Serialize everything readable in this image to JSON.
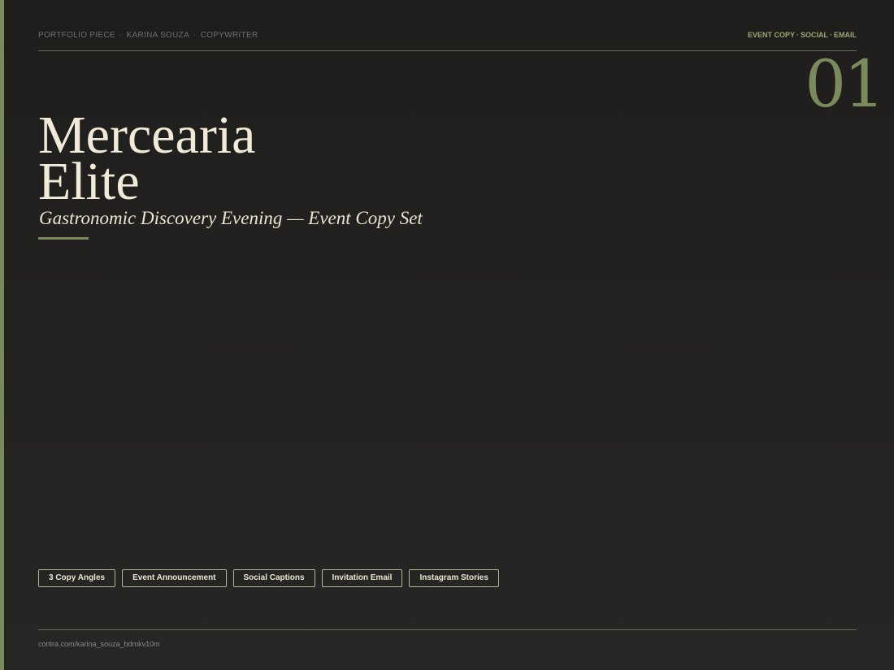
{
  "header": {
    "left_items": [
      "PORTFOLIO PIECE",
      "KARINA SOUZA",
      "COPYWRITER"
    ],
    "separator": "·",
    "right_items": [
      "EVENT COPY",
      "SOCIAL",
      "EMAIL"
    ]
  },
  "page_number": "01",
  "title": {
    "line1": "Mercearia",
    "line2": "Elite"
  },
  "subtitle": "Gastronomic Discovery Evening — Event Copy Set",
  "tags": [
    "3 Copy Angles",
    "Event Announcement",
    "Social Captions",
    "Invitation Email",
    "Instagram Stories"
  ],
  "footer": {
    "url": "contra.com/karina_souza_bdmkv10m"
  },
  "colors": {
    "accent": "#7a8a5c",
    "background": "#1f1e1c",
    "text_primary": "#f2ead8"
  }
}
